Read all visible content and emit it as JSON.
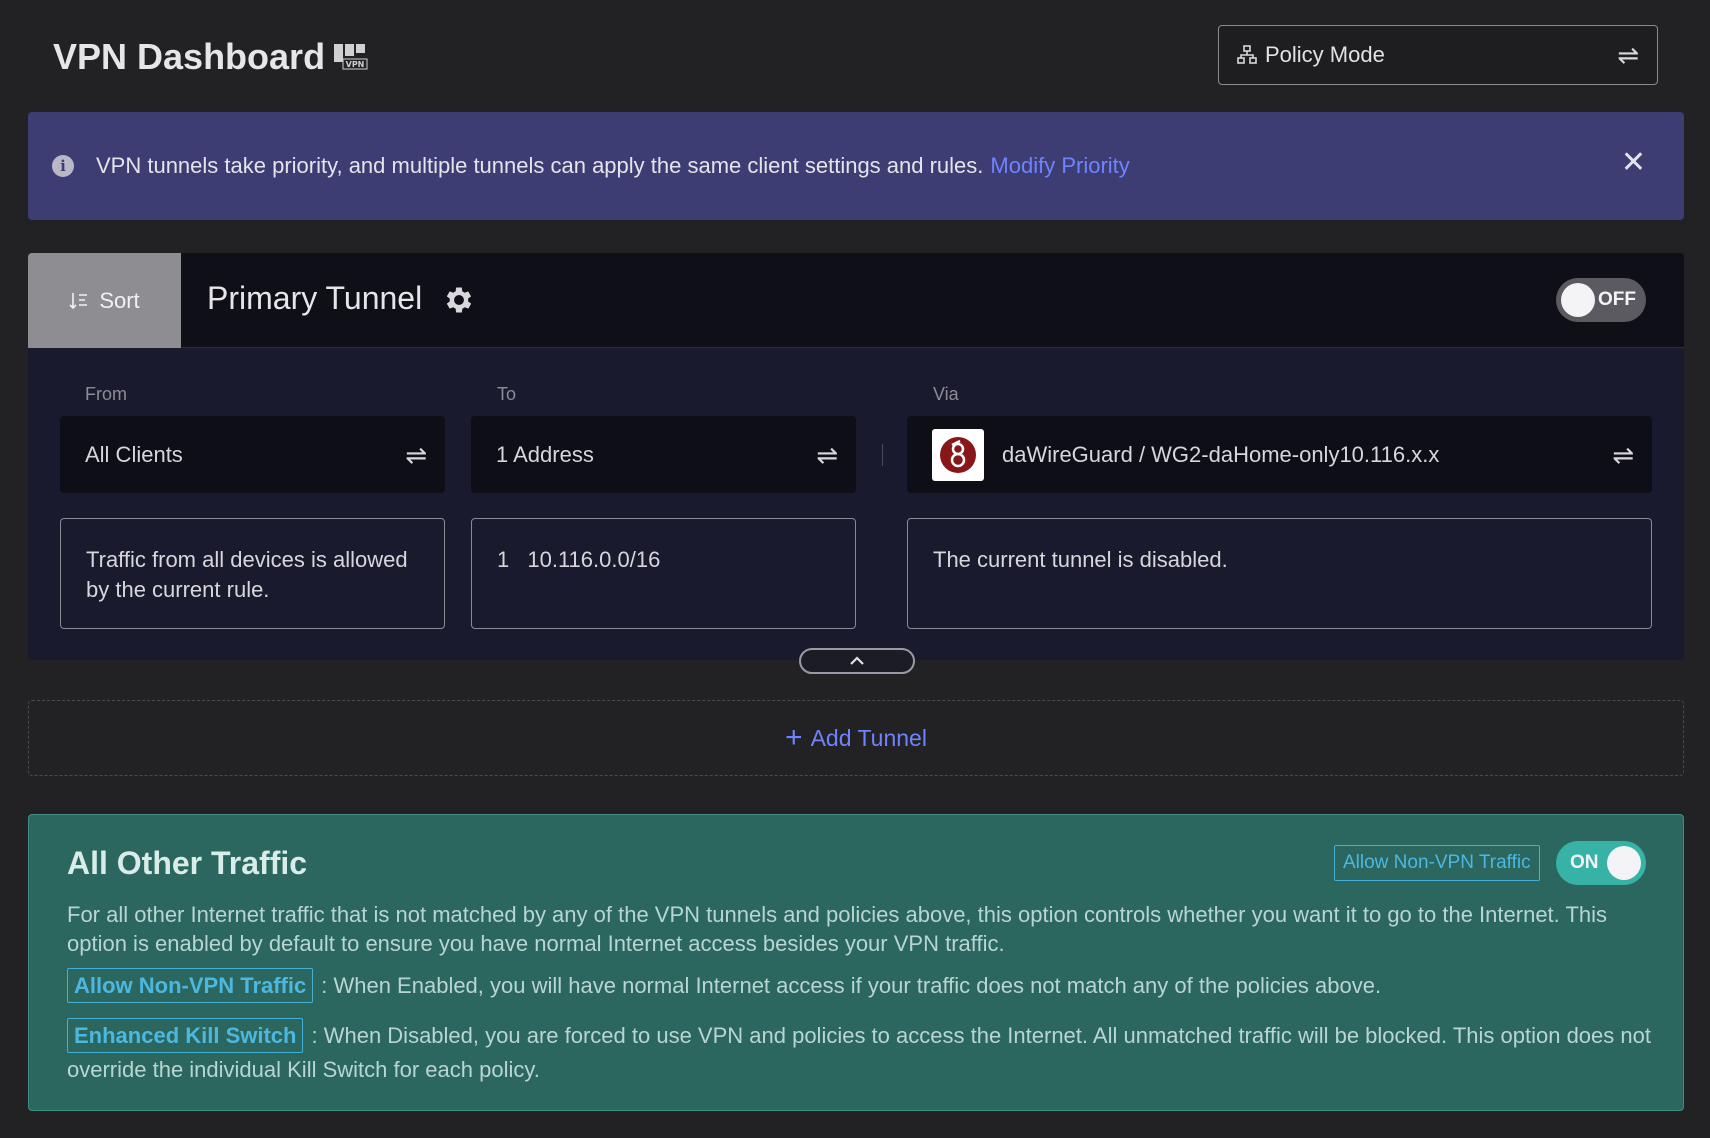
{
  "header": {
    "title": "VPN Dashboard",
    "badge_text": "VPN",
    "mode_label": "Policy Mode"
  },
  "banner": {
    "text": "VPN tunnels take priority, and multiple tunnels can apply the same client settings and rules.",
    "link": "Modify Priority"
  },
  "tunnel": {
    "sort_label": "Sort",
    "name": "Primary Tunnel",
    "toggle_label": "OFF",
    "from_label": "From",
    "to_label": "To",
    "via_label": "Via",
    "from_value": "All Clients",
    "to_value": "1 Address",
    "via_value": "daWireGuard / WG2-daHome-only10.116.x.x",
    "from_desc": "Traffic from all devices is allowed by the current rule.",
    "to_desc_index": "1",
    "to_desc_value": "10.116.0.0/16",
    "via_desc": "The current tunnel is disabled."
  },
  "add_tunnel": {
    "label": "Add Tunnel"
  },
  "other": {
    "title": "All Other Traffic",
    "tag": "Allow Non-VPN Traffic",
    "toggle_label": "ON",
    "description": "For all other Internet traffic that is not matched by any of the VPN tunnels and policies above, this option controls whether you want it to go to the Internet. This option is enabled by default to ensure you have normal Internet access besides your VPN traffic.",
    "items": [
      {
        "tag": "Allow Non-VPN Traffic",
        "text": ": When Enabled, you will have normal Internet access if your traffic does not match any of the policies above."
      },
      {
        "tag": "Enhanced Kill Switch",
        "text": ": When Disabled, you are forced to use VPN and policies to access the Internet. All unmatched traffic will be blocked. This option does not override the individual Kill Switch for each policy."
      }
    ]
  },
  "colors": {
    "background": "#222224",
    "banner": "#3d3d73",
    "link": "#6e83ff",
    "tunnel_card": "#1a1a2e",
    "other_panel": "#2b665f",
    "toggle_on": "#36b3a6",
    "tag_outline": "#43b0d6"
  },
  "icons": [
    "vpn-badge-icon",
    "network-icon",
    "swap-icon",
    "info-icon",
    "close-icon",
    "sort-icon",
    "gear-icon",
    "wireguard-logo-icon",
    "chevron-up-icon",
    "plus-icon"
  ]
}
